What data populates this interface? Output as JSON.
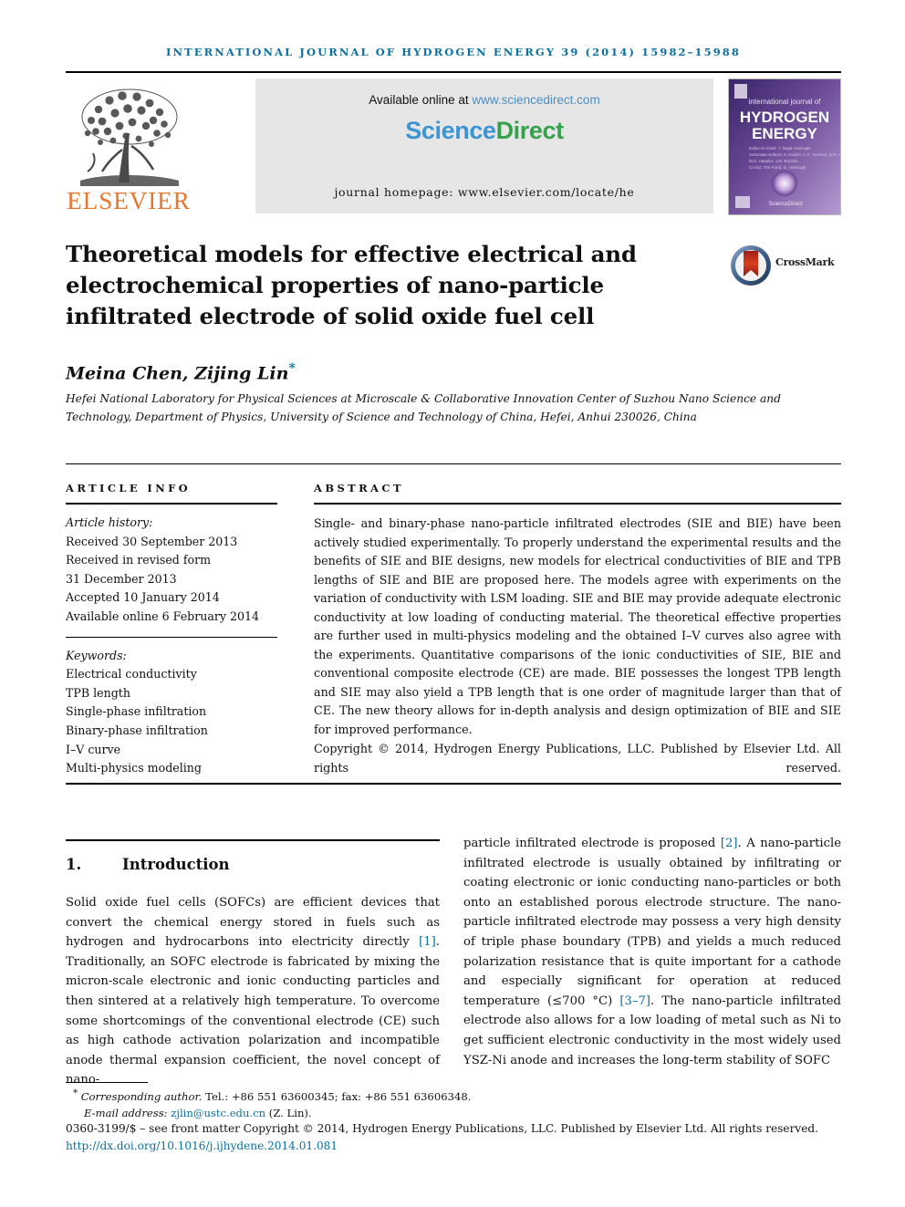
{
  "running_head": "international journal of hydrogen energy 39 (2014) 15982–15988",
  "masthead": {
    "publisher_logo_name": "ELSEVIER",
    "available_online_prefix": "Available online at ",
    "available_online_url": "www.sciencedirect.com",
    "sciencedirect_part1": "Science",
    "sciencedirect_part2": "Direct",
    "journal_homepage": "journal homepage: www.elsevier.com/locate/he",
    "cover": {
      "line1": "international journal of",
      "line2": "HYDROGEN",
      "line3": "ENERGY",
      "footer_brand": "ScienceDirect"
    }
  },
  "article": {
    "title": "Theoretical models for effective electrical and electrochemical properties of nano-particle infiltrated electrode of solid oxide fuel cell",
    "crossmark_label": "CrossMark",
    "authors": "Meina Chen, Zijing Lin",
    "author_footnote_marker": "*",
    "affiliation": "Hefei National Laboratory for Physical Sciences at Microscale & Collaborative Innovation Center of Suzhou Nano Science and Technology, Department of Physics, University of Science and Technology of China, Hefei, Anhui 230026, China"
  },
  "article_info": {
    "heading": "ARTICLE INFO",
    "history_label": "Article history:",
    "history": [
      "Received 30 September 2013",
      "Received in revised form",
      "31 December 2013",
      "Accepted 10 January 2014",
      "Available online 6 February 2014"
    ],
    "keywords_label": "Keywords:",
    "keywords": [
      "Electrical conductivity",
      "TPB length",
      "Single-phase infiltration",
      "Binary-phase infiltration",
      "I–V curve",
      "Multi-physics modeling"
    ]
  },
  "abstract": {
    "heading": "ABSTRACT",
    "text": "Single- and binary-phase nano-particle infiltrated electrodes (SIE and BIE) have been actively studied experimentally. To properly understand the experimental results and the benefits of SIE and BIE designs, new models for electrical conductivities of BIE and TPB lengths of SIE and BIE are proposed here. The models agree with experiments on the variation of conductivity with LSM loading. SIE and BIE may provide adequate electronic conductivity at low loading of conducting material. The theoretical effective properties are further used in multi-physics modeling and the obtained I–V curves also agree with the experiments. Quantitative comparisons of the ionic conductivities of SIE, BIE and conventional composite electrode (CE) are made. BIE possesses the longest TPB length and SIE may also yield a TPB length that is one order of magnitude larger than that of CE. The new theory allows for in-depth analysis and design optimization of BIE and SIE for improved performance.",
    "copyright": "Copyright © 2014, Hydrogen Energy Publications, LLC. Published by Elsevier Ltd. All rights reserved."
  },
  "body": {
    "section_number": "1.",
    "section_title": "Introduction",
    "left_paragraph_pre": "Solid oxide fuel cells (SOFCs) are efficient devices that convert the chemical energy stored in fuels such as hydrogen and hydrocarbons into electricity directly ",
    "left_ref_1": "[1]",
    "left_paragraph_post": ". Traditionally, an SOFC electrode is fabricated by mixing the micron-scale electronic and ionic conducting particles and then sintered at a relatively high temperature. To overcome some shortcomings of the conventional electrode (CE) such as high cathode activation polarization and incompatible anode thermal expansion coefficient, the novel concept of nano-",
    "right_paragraph_pre": "particle infiltrated electrode is proposed ",
    "right_ref_2": "[2]",
    "right_paragraph_mid": ". A nano-particle infiltrated electrode is usually obtained by infiltrating or coating electronic or ionic conducting nano-particles or both onto an established porous electrode structure. The nano-particle infiltrated electrode may possess a very high density of triple phase boundary (TPB) and yields a much reduced polarization resistance that is quite important for a cathode and especially significant for operation at reduced temperature (≤700 °C) ",
    "right_ref_37": "[3–7]",
    "right_paragraph_post": ". The nano-particle infiltrated electrode also allows for a low loading of metal such as Ni to get sufficient electronic conductivity in the most widely used YSZ-Ni anode and increases the long-term stability of SOFC"
  },
  "footer": {
    "corresponding_marker": "*",
    "corresponding_label": "Corresponding author.",
    "corresponding_contact": " Tel.: +86 551 63600345; fax: +86 551 63606348.",
    "email_label": "E-mail address: ",
    "email": "zjlin@ustc.edu.cn",
    "email_suffix": " (Z. Lin).",
    "issn_line": "0360-3199/$ – see front matter Copyright © 2014, Hydrogen Energy Publications, LLC. Published by Elsevier Ltd. All rights reserved.",
    "doi": "http://dx.doi.org/10.1016/j.ijhydene.2014.01.081"
  },
  "colors": {
    "link": "#0a6ea0",
    "sciencedirect_blue": "#3b95d3",
    "sciencedirect_green": "#35a14a",
    "elsevier_orange": "#e8762c",
    "band_gray": "#e6e6e6"
  }
}
